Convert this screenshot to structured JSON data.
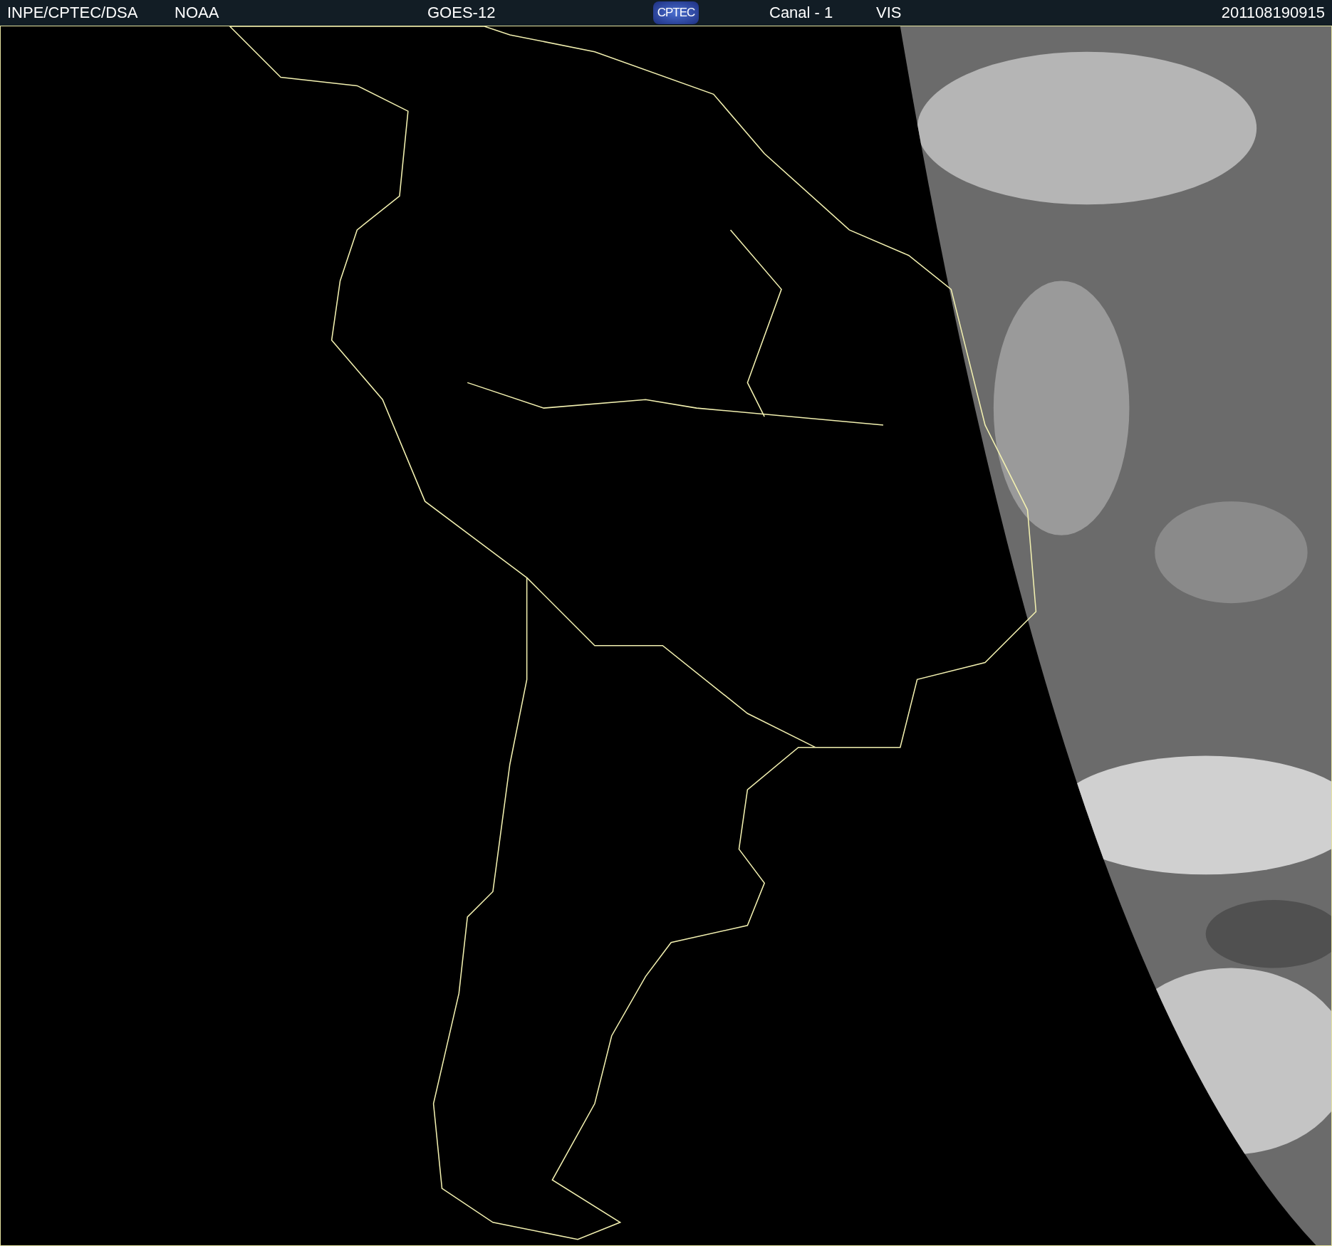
{
  "header": {
    "source": "INPE/CPTEC/DSA",
    "agency": "NOAA",
    "satellite": "GOES-12",
    "logo": "CPTEC",
    "channel": "Canal - 1",
    "band": "VIS",
    "timestamp": "201108190915"
  }
}
